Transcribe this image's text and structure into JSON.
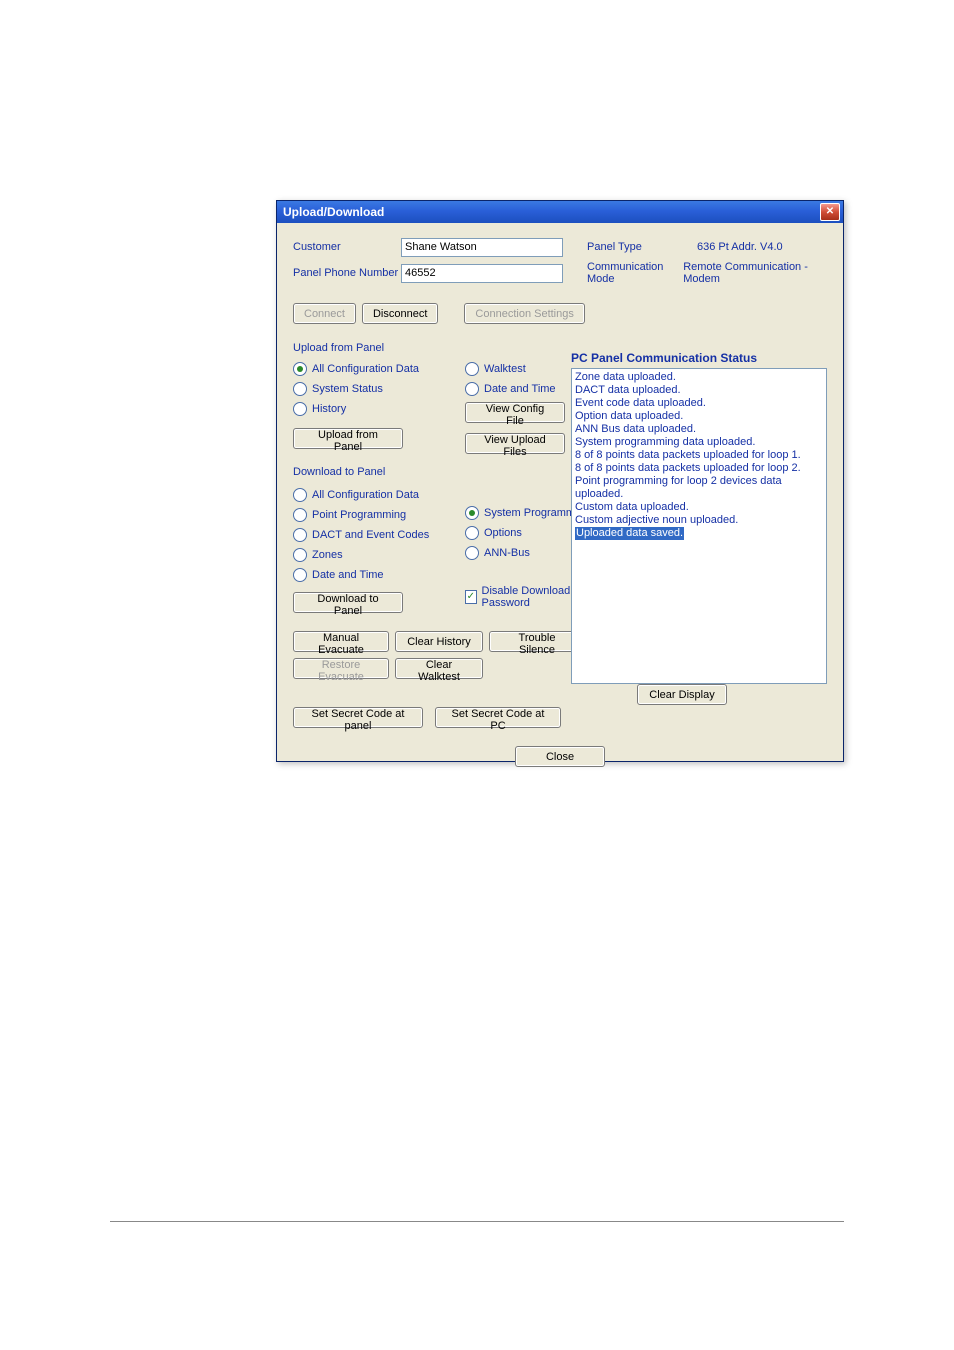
{
  "window": {
    "title": "Upload/Download"
  },
  "info": {
    "customer_label": "Customer",
    "customer_value": "Shane Watson",
    "phone_label": "Panel Phone Number",
    "phone_value": "46552",
    "panel_type_label": "Panel Type",
    "panel_type_value": "636 Pt Addr. V4.0",
    "comm_mode_label": "Communication Mode",
    "comm_mode_value": "Remote Communication - Modem"
  },
  "buttons": {
    "connect": "Connect",
    "disconnect": "Disconnect",
    "connection_settings": "Connection Settings",
    "upload_from_panel": "Upload from Panel",
    "view_config_file": "View Config File",
    "view_upload_files": "View Upload Files",
    "download_to_panel": "Download to Panel",
    "manual_evacuate": "Manual Evacuate",
    "clear_history": "Clear History",
    "trouble_silence": "Trouble Silence",
    "restore_evacuate": "Restore Evacuate",
    "clear_walktest": "Clear Walktest",
    "set_secret_panel": "Set Secret Code at panel",
    "set_secret_pc": "Set Secret Code at PC",
    "clear_display": "Clear Display",
    "close": "Close"
  },
  "sections": {
    "upload_from_panel": "Upload from Panel",
    "download_to_panel": "Download to Panel"
  },
  "upload_options": {
    "all_config": "All Configuration Data",
    "system_status": "System Status",
    "history": "History",
    "walktest": "Walktest",
    "date_time": "Date and Time"
  },
  "download_options": {
    "all_config": "All Configuration Data",
    "point_programming": "Point Programming",
    "dact": "DACT and Event Codes",
    "zones": "Zones",
    "date_time": "Date and Time",
    "system_programming": "System Programming",
    "options": "Options",
    "ann_bus": "ANN-Bus",
    "disable_download_pw": "Disable Download Password"
  },
  "status": {
    "title": "PC Panel Communication Status",
    "lines": [
      "Zone data uploaded.",
      "DACT data uploaded.",
      "Event code data uploaded.",
      "Option data uploaded.",
      "ANN Bus data uploaded.",
      "System programming data uploaded.",
      "8 of 8 points data packets uploaded for loop 1.",
      "8 of 8 points data packets uploaded for loop 2.",
      "Point programming for loop 2 devices data uploaded.",
      "Custom data uploaded.",
      "Custom adjective noun uploaded."
    ],
    "highlighted": "Uploaded data saved."
  }
}
